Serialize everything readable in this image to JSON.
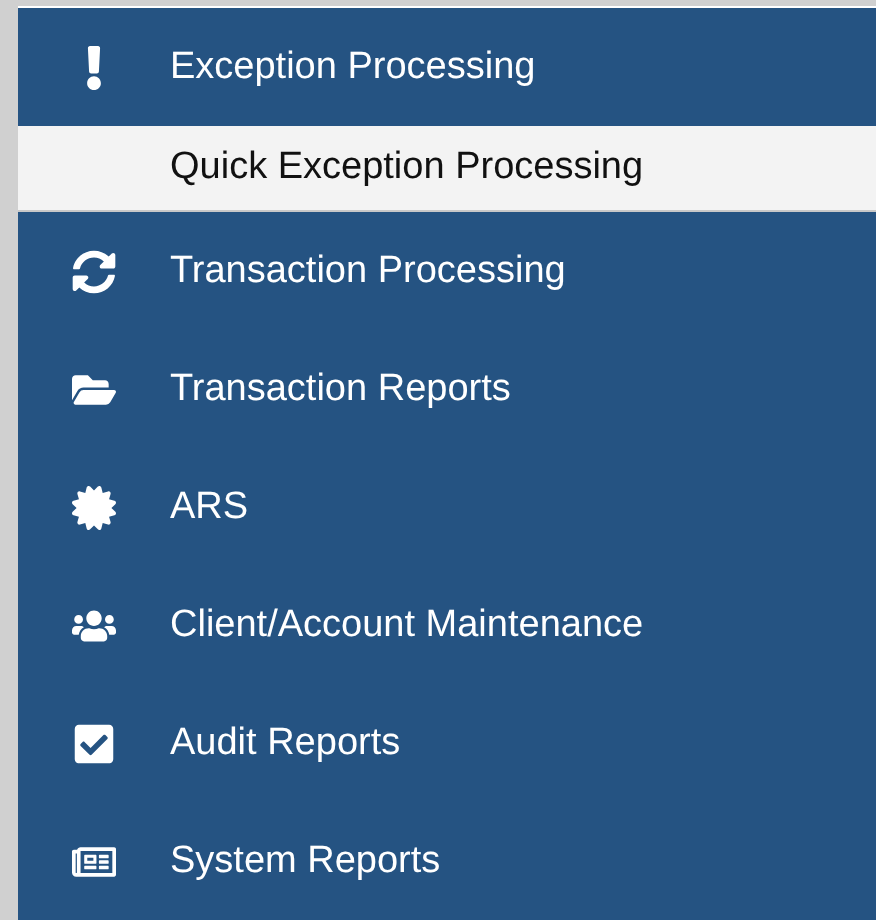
{
  "menu": [
    {
      "label": "Exception Processing",
      "expanded": true,
      "children": [
        {
          "label": "Quick Exception Processing"
        }
      ]
    },
    {
      "label": "Transaction Processing"
    },
    {
      "label": "Transaction Reports"
    },
    {
      "label": "ARS"
    },
    {
      "label": "Client/Account Maintenance"
    },
    {
      "label": "Audit Reports"
    },
    {
      "label": "System Reports"
    }
  ]
}
